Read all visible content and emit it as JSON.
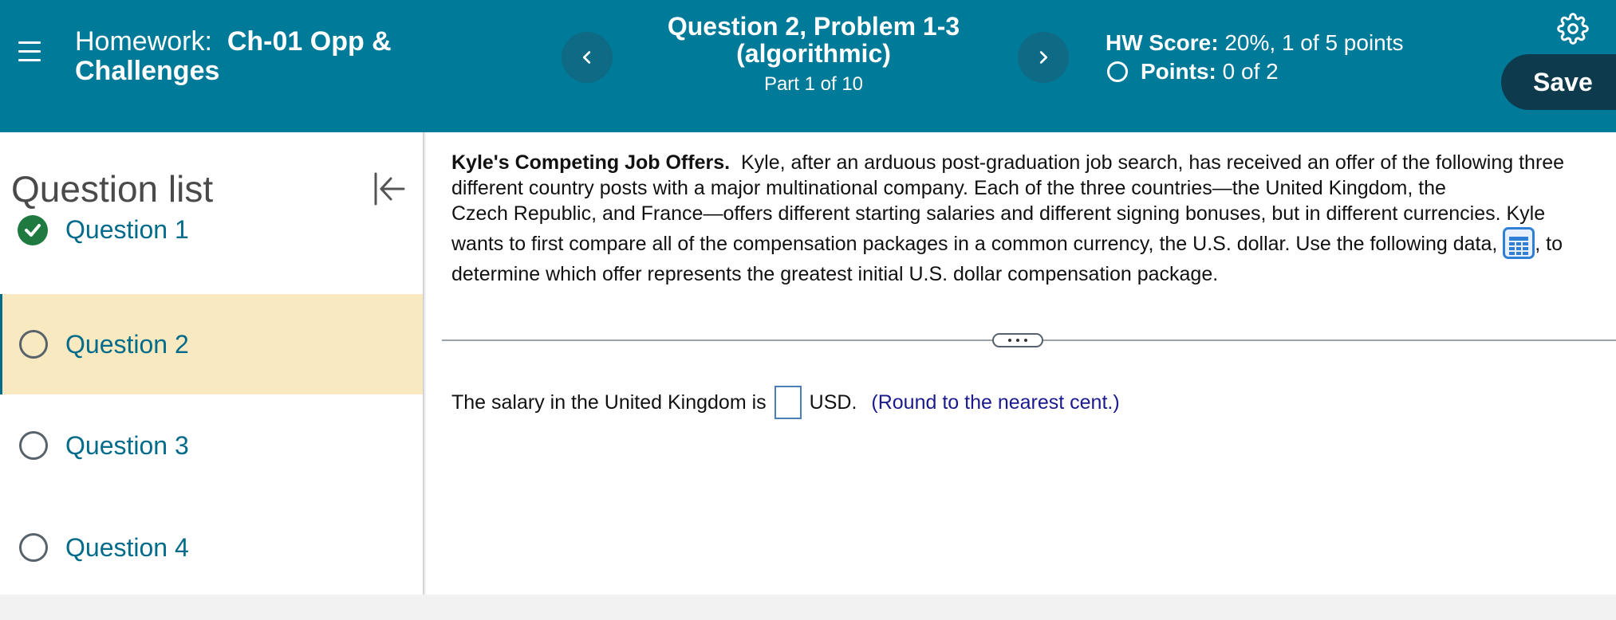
{
  "header": {
    "homework_label": "Homework:",
    "homework_name": "Ch-01 Opp & Challenges",
    "question_title": "Question 2, Problem 1-3 (algorithmic)",
    "part": "Part 1 of 10",
    "hw_score_label": "HW Score:",
    "hw_score_value": "20%, 1 of 5 points",
    "points_label": "Points:",
    "points_value": "0 of 2",
    "save_label": "Save",
    "colors": {
      "header_bg": "#007a99",
      "save_bg": "#0d3a4c"
    }
  },
  "sidebar": {
    "title": "Question list",
    "questions": [
      {
        "label": "Question 1",
        "status": "correct"
      },
      {
        "label": "Question 2",
        "status": "current"
      },
      {
        "label": "Question 3",
        "status": "unanswered"
      },
      {
        "label": "Question 4",
        "status": "unanswered"
      }
    ]
  },
  "problem": {
    "title": "Kyle's Competing Job Offers.",
    "line1": "Kyle, after an arduous post-graduation job search, has received an offer of the following three",
    "line2": "different country posts with a major multinational company. Each of the three countries—the United Kingdom, the",
    "line3": "Czech Republic, and France—offers different starting salaries and different signing bonuses, but in different currencies. Kyle",
    "line4a": "wants to first compare all of the compensation packages in a common currency, the U.S. dollar. Use the following data,",
    "line4b": ", to",
    "line5": "determine which offer represents the greatest initial U.S. dollar compensation package.",
    "answer_prefix": "The salary in the United Kingdom is",
    "answer_value": "",
    "answer_unit": "USD.",
    "answer_hint": "(Round to the nearest cent.)"
  }
}
